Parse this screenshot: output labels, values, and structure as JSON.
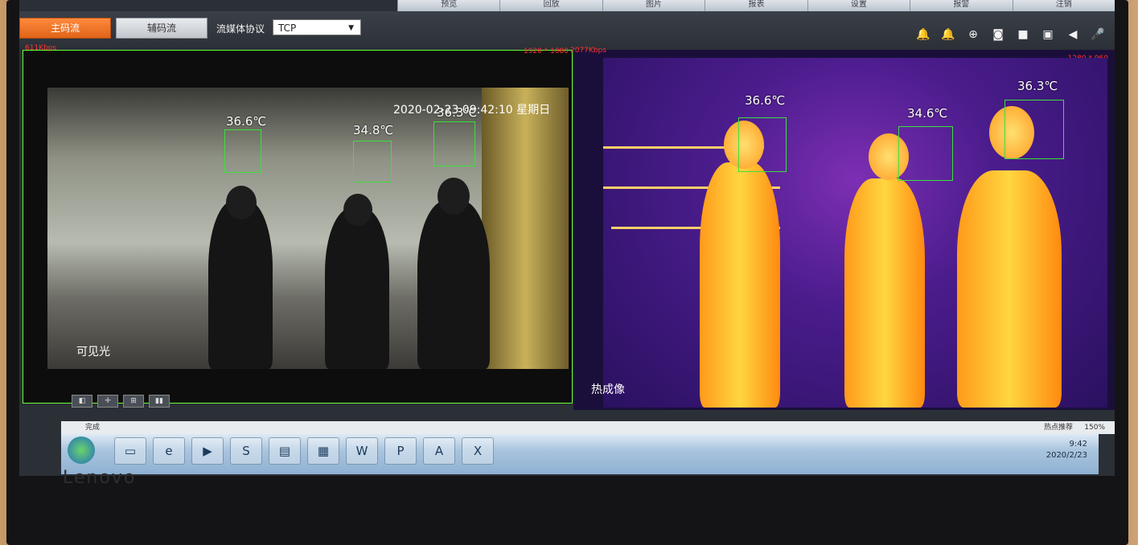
{
  "top_tabs": [
    "预览",
    "回放",
    "图片",
    "报表",
    "设置",
    "报警",
    "注销"
  ],
  "toolbar": {
    "main_stream": "主码流",
    "sub_stream": "辅码流",
    "protocol_label": "流媒体协议",
    "protocol_value": "TCP",
    "icons": [
      "bell-icon",
      "alarm-icon",
      "zoom-icon",
      "snapshot-icon",
      "record-icon",
      "camera-icon",
      "audio-icon",
      "mic-icon"
    ]
  },
  "left_pane": {
    "bitrate": "611Kbps",
    "resolution": "1920 * 1080",
    "timestamp": "2020-02-23 09:42:10 星期日",
    "label": "可见光",
    "temps": [
      "36.6℃",
      "34.8℃",
      "36.3℃"
    ]
  },
  "right_pane": {
    "bitrate": "2077Kbps",
    "resolution": "1280 * 960",
    "label": "热成像",
    "temps": [
      "36.6℃",
      "34.6℃",
      "36.3℃"
    ]
  },
  "status_bar": {
    "text": "完成",
    "zoom": "150%",
    "hot_news": "热点推荐"
  },
  "taskbar": {
    "apps": [
      "cmd",
      "ie",
      "media",
      "sogou",
      "folder",
      "winrar",
      "word",
      "ppt",
      "pdf",
      "excel"
    ],
    "time": "9:42",
    "date": "2020/2/23"
  },
  "brand": "Lenovo"
}
